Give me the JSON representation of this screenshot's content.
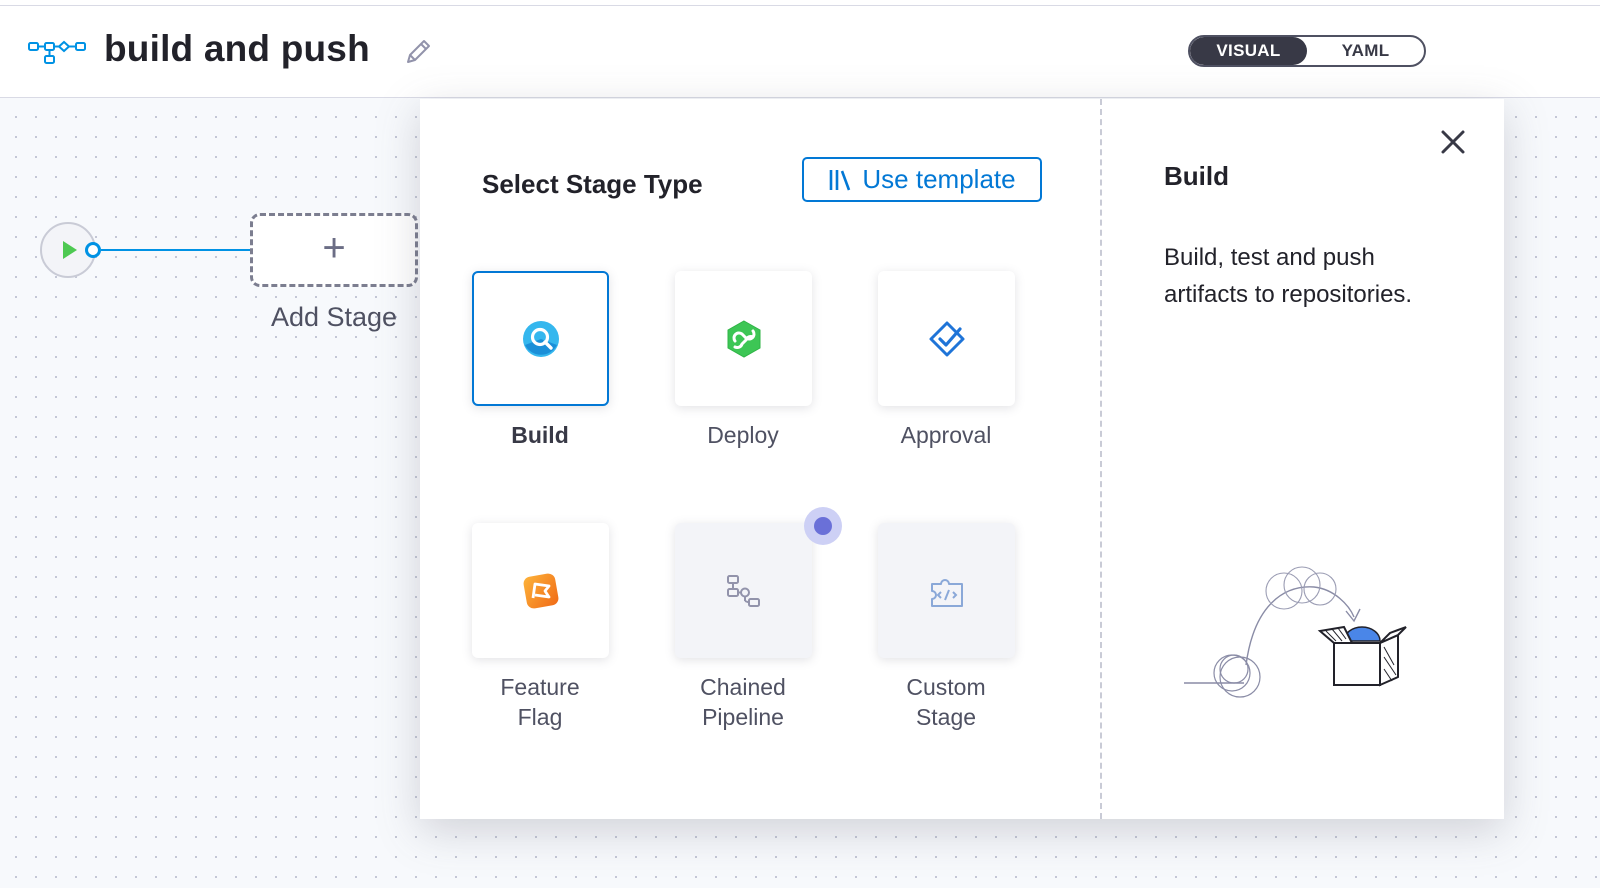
{
  "header": {
    "title": "build and push",
    "pipeline_icon": "pipeline-icon",
    "edit_icon": "pencil-icon",
    "view_toggle": {
      "options": [
        "VISUAL",
        "YAML"
      ],
      "selected": "VISUAL"
    }
  },
  "canvas": {
    "start_icon": "play-icon",
    "add_stage_label": "Add Stage",
    "add_icon": "plus-icon"
  },
  "stage_panel": {
    "title": "Select Stage Type",
    "use_template_label": "Use template",
    "template_icon": "library-icon",
    "stages": [
      {
        "id": "build",
        "label": "Build",
        "icon": "build-icon",
        "selected": true,
        "disabled": false
      },
      {
        "id": "deploy",
        "label": "Deploy",
        "icon": "deploy-icon",
        "selected": false,
        "disabled": false
      },
      {
        "id": "approval",
        "label": "Approval",
        "icon": "approval-icon",
        "selected": false,
        "disabled": false
      },
      {
        "id": "feature-flag",
        "label_line1": "Feature",
        "label_line2": "Flag",
        "icon": "feature-flag-icon",
        "selected": false,
        "disabled": false
      },
      {
        "id": "chained-pipeline",
        "label_line1": "Chained",
        "label_line2": "Pipeline",
        "icon": "chained-pipeline-icon",
        "selected": false,
        "disabled": true
      },
      {
        "id": "custom-stage",
        "label_line1": "Custom",
        "label_line2": "Stage",
        "icon": "custom-stage-icon",
        "selected": false,
        "disabled": true
      }
    ]
  },
  "info_panel": {
    "title": "Build",
    "description": "Build, test and push artifacts to repositories.",
    "close_icon": "close-icon",
    "illustration": "box-illustration"
  },
  "colors": {
    "accent": "#0278d5",
    "link": "#0092e4",
    "toggle_active": "#383946",
    "deploy": "#3dc655",
    "feature_flag": "#f07d1a"
  }
}
